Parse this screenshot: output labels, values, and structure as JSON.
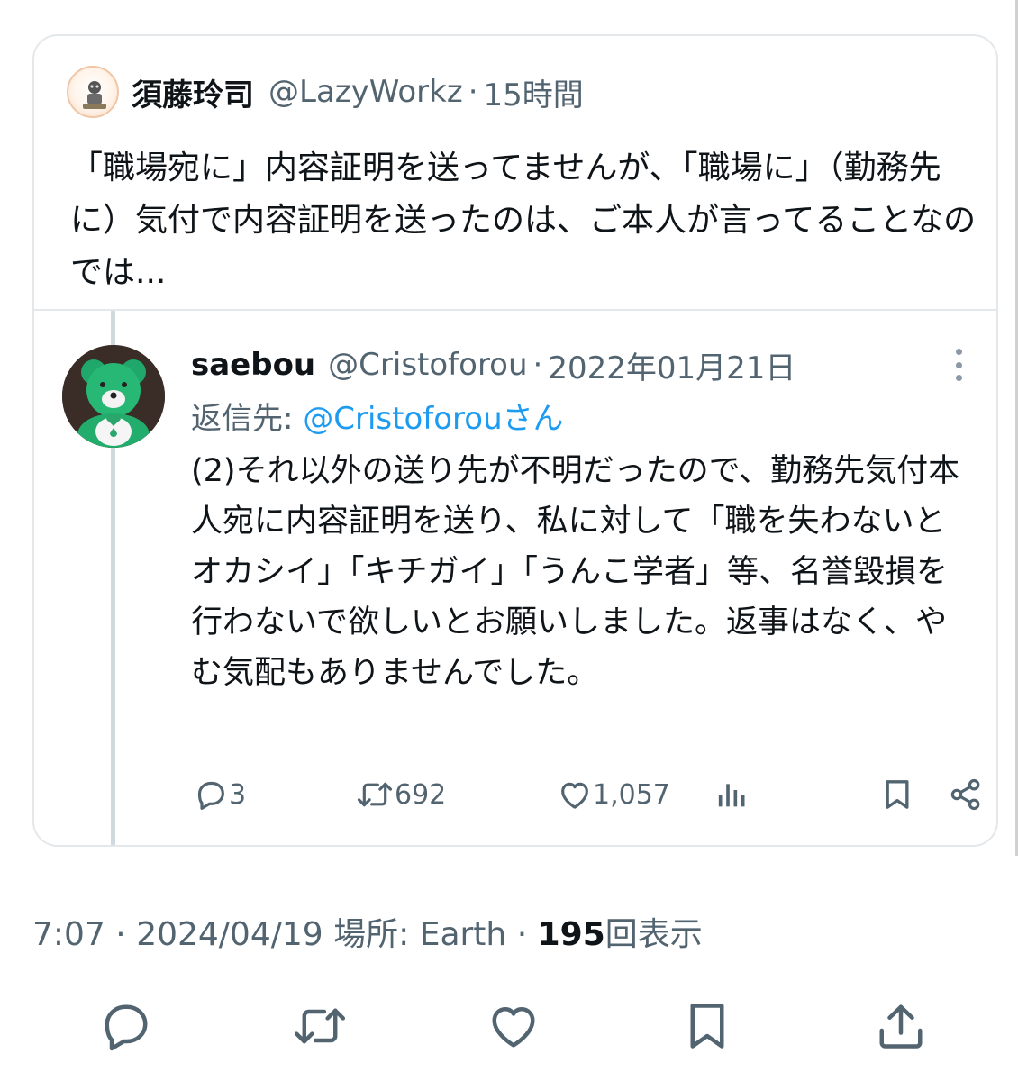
{
  "quoted_tweet": {
    "author_name": "須藤玲司",
    "author_handle": "@LazyWorkz",
    "separator": "·",
    "time": "15時間",
    "text": "「職場宛に」内容証明を送ってませんが、「職場に」（勤務先に）気付で内容証明を送ったのは、ご本人が言ってることなのでは..."
  },
  "embedded_tweet": {
    "author_name": "saebou",
    "author_handle": "@Cristoforou",
    "separator": "·",
    "date": "2022年01月21日",
    "reply_label": "返信先: ",
    "reply_handle": "@Cristoforouさん",
    "text": "(2)それ以外の送り先が不明だったので、勤務先気付本人宛に内容証明を送り、私に対して「職を失わないとオカシイ」「キチガイ」「うんこ学者」等、名誉毀損を行わないで欲しいとお願いしました。返事はなく、やむ気配もありませんでした。",
    "reply_count": "3",
    "retweet_count": "692",
    "like_count": "1,057"
  },
  "meta": {
    "time": "7:07",
    "separator1": " · ",
    "date": "2024/04/19",
    "location_label": " 場所: Earth",
    "separator2": " · ",
    "views_count": "195",
    "views_label": "回表示"
  },
  "icons": {
    "reply": "reply-icon",
    "retweet": "retweet-icon",
    "like": "heart-icon",
    "analytics": "analytics-icon",
    "bookmark": "bookmark-icon",
    "share": "share-icon",
    "more": "more-vertical-icon"
  },
  "colors": {
    "accent": "#1d9bf0",
    "secondary_text": "#536471",
    "primary_text": "#0f1419",
    "border": "#e4e8eb"
  }
}
